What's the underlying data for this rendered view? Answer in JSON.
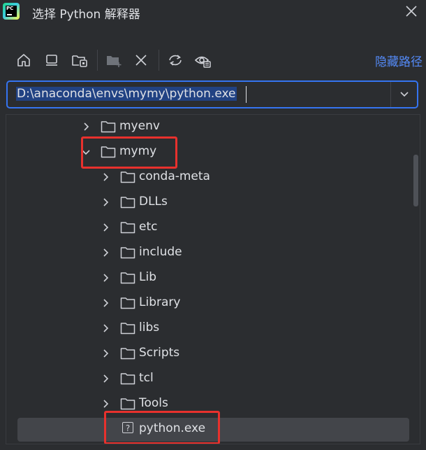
{
  "window": {
    "title": "选择 Python 解释器",
    "app_logo": "pycharm-logo",
    "close_icon": "close-icon"
  },
  "toolbar": {
    "buttons": [
      {
        "icon": "home-icon"
      },
      {
        "icon": "desktop-icon"
      },
      {
        "icon": "project-folder-icon"
      },
      {
        "icon": "new-folder-icon"
      },
      {
        "icon": "delete-icon"
      },
      {
        "icon": "refresh-icon"
      },
      {
        "icon": "show-hidden-icon"
      }
    ],
    "hide_path_label": "隐藏路径"
  },
  "path_field": {
    "value": "D:\\anaconda\\envs\\mymy\\python.exe"
  },
  "tree": {
    "items": [
      {
        "label": "myenv",
        "type": "folder",
        "expanded": false
      },
      {
        "label": "mymy",
        "type": "folder",
        "expanded": true
      },
      {
        "label": "conda-meta",
        "type": "folder",
        "expanded": false
      },
      {
        "label": "DLLs",
        "type": "folder",
        "expanded": false
      },
      {
        "label": "etc",
        "type": "folder",
        "expanded": false
      },
      {
        "label": "include",
        "type": "folder",
        "expanded": false
      },
      {
        "label": "Lib",
        "type": "folder",
        "expanded": false
      },
      {
        "label": "Library",
        "type": "folder",
        "expanded": false
      },
      {
        "label": "libs",
        "type": "folder",
        "expanded": false
      },
      {
        "label": "Scripts",
        "type": "folder",
        "expanded": false
      },
      {
        "label": "tcl",
        "type": "folder",
        "expanded": false
      },
      {
        "label": "Tools",
        "type": "folder",
        "expanded": false
      },
      {
        "label": "python.exe",
        "type": "file",
        "selected": true
      }
    ]
  },
  "colors": {
    "accent": "#3574f0",
    "link": "#548af7",
    "highlight": "#e8312d",
    "background": "#2b2d30",
    "selection": "#43454a"
  }
}
